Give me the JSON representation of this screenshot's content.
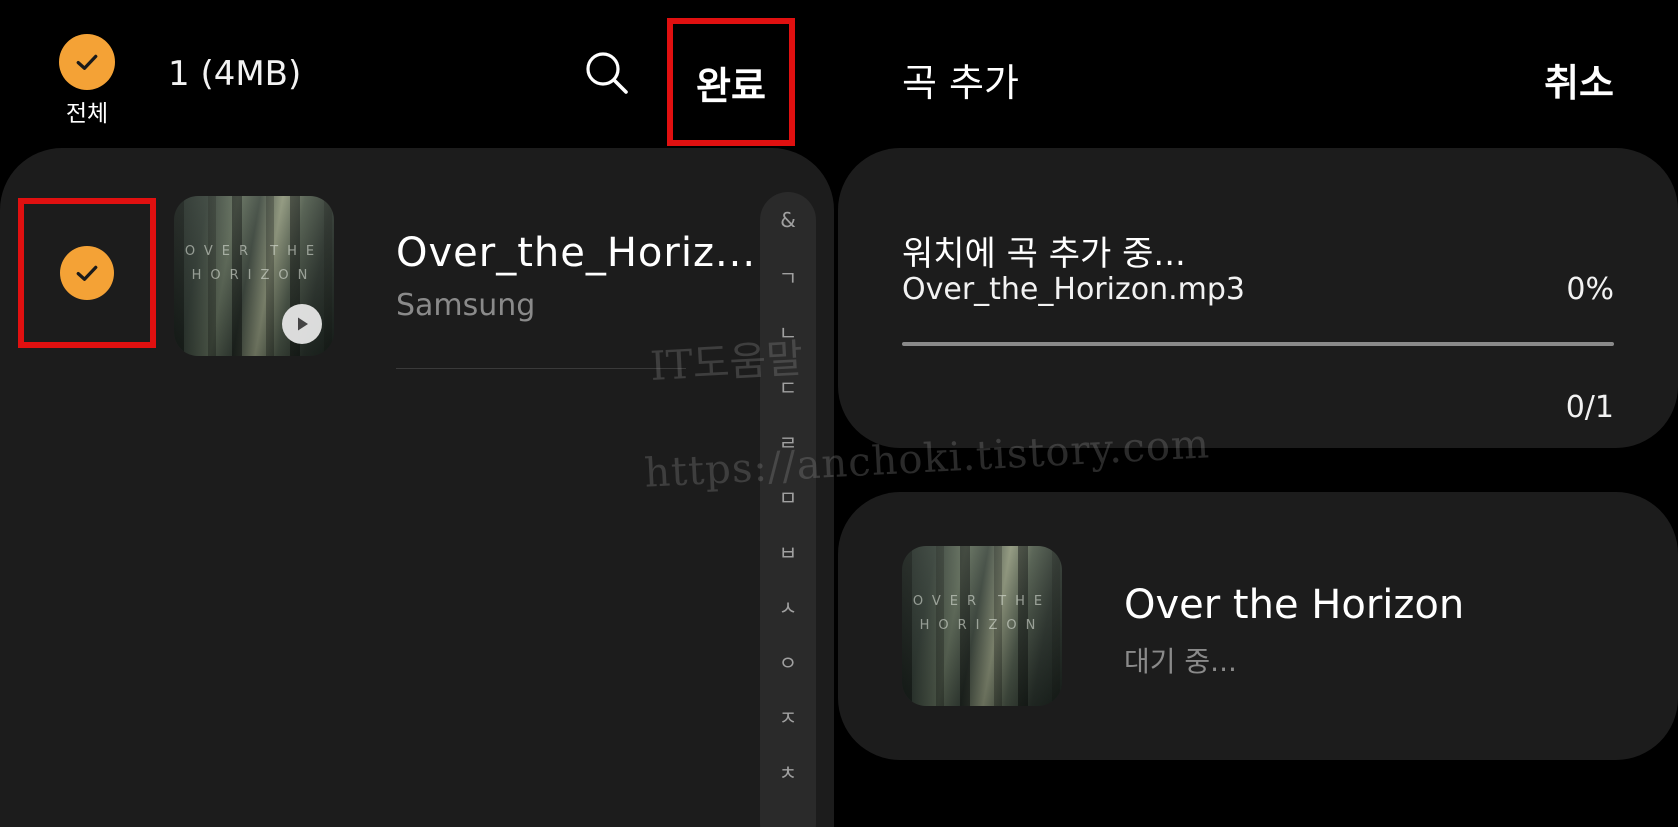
{
  "left": {
    "select_all_label": "전체",
    "selected_count": "1 (4MB)",
    "done_label": "완료",
    "song": {
      "title": "Over_the_Horiz...",
      "artist": "Samsung",
      "album_art_text": "OVER THE HORIZON"
    },
    "index_letters": [
      "&",
      "ㄱ",
      "ㄴ",
      "ㄷ",
      "ㄹ",
      "ㅁ",
      "ㅂ",
      "ㅅ",
      "ㅇ",
      "ㅈ",
      "ㅊ"
    ]
  },
  "watermark": {
    "line1": "IT도움말",
    "line2": "https://anchoki.tistory.com"
  },
  "right": {
    "title": "곡 추가",
    "cancel_label": "취소",
    "progress": {
      "heading": "워치에 곡 추가 중...",
      "file": "Over_the_Horizon.mp3",
      "percent_text": "0%",
      "fraction": 0,
      "count": "0/1"
    },
    "queue_item": {
      "title": "Over the Horizon",
      "status": "대기 중...",
      "album_art_text": "OVER THE HORIZON"
    }
  },
  "colors": {
    "accent": "#f4a236",
    "highlight_box": "#e01010",
    "card_bg": "#1c1c1c"
  },
  "icons": [
    "check-icon",
    "search-icon",
    "play-icon"
  ]
}
